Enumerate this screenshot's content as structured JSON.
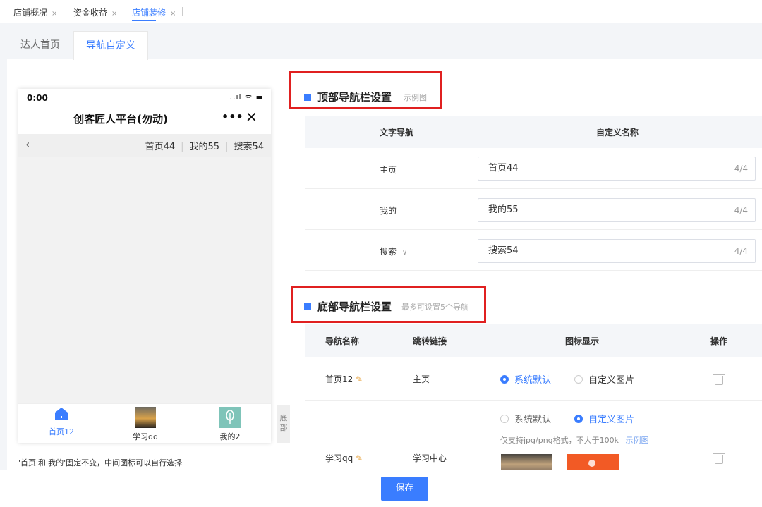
{
  "page_tabs": [
    {
      "label": "店铺概况",
      "close": "×"
    },
    {
      "label": "资金收益",
      "close": "×"
    },
    {
      "label": "店铺装修",
      "close": "×"
    }
  ],
  "sub_tabs": [
    "达人首页",
    "导航自定义"
  ],
  "phone": {
    "time": "0:00",
    "status": "..ıl ᯤ ▬",
    "title": "创客匠人平台(勿动)",
    "dots": "•••",
    "close": "✕",
    "back": "‹",
    "nav_items": [
      "首页44",
      "我的55",
      "搜索54"
    ],
    "bottom_items": [
      "首页12",
      "学习qq",
      "我的2"
    ]
  },
  "side_tag": "底部",
  "note": "'首页'和'我的'固定不变，中间图标可以自行选择",
  "top_nav": {
    "title": "顶部导航栏设置",
    "hint": "示例图",
    "col_text_nav": "文字导航",
    "col_custom_name": "自定义名称",
    "rows": [
      {
        "nav": "主页",
        "value": "首页44",
        "count": "4/4"
      },
      {
        "nav": "我的",
        "value": "我的55",
        "count": "4/4"
      },
      {
        "nav": "搜索",
        "value": "搜索54",
        "count": "4/4",
        "chevron": "∨"
      }
    ]
  },
  "bottom_nav": {
    "title": "底部导航栏设置",
    "hint": "最多可设置5个导航",
    "col_name": "导航名称",
    "col_link": "跳转链接",
    "col_icon": "图标显示",
    "col_op": "操作",
    "rows": [
      {
        "name": "首页12",
        "link": "主页",
        "opt_default": "系统默认",
        "opt_custom": "自定义图片",
        "selected": "default"
      },
      {
        "name": "学习qq",
        "link": "学习中心",
        "opt_default": "系统默认",
        "opt_custom": "自定义图片",
        "selected": "custom",
        "format_hint": "仅支持jpg/png格式，不大于100k",
        "example": "示例图"
      }
    ]
  },
  "save_label": "保存",
  "colors": {
    "accent": "#3a7dff",
    "highlight_box": "#e02020"
  }
}
